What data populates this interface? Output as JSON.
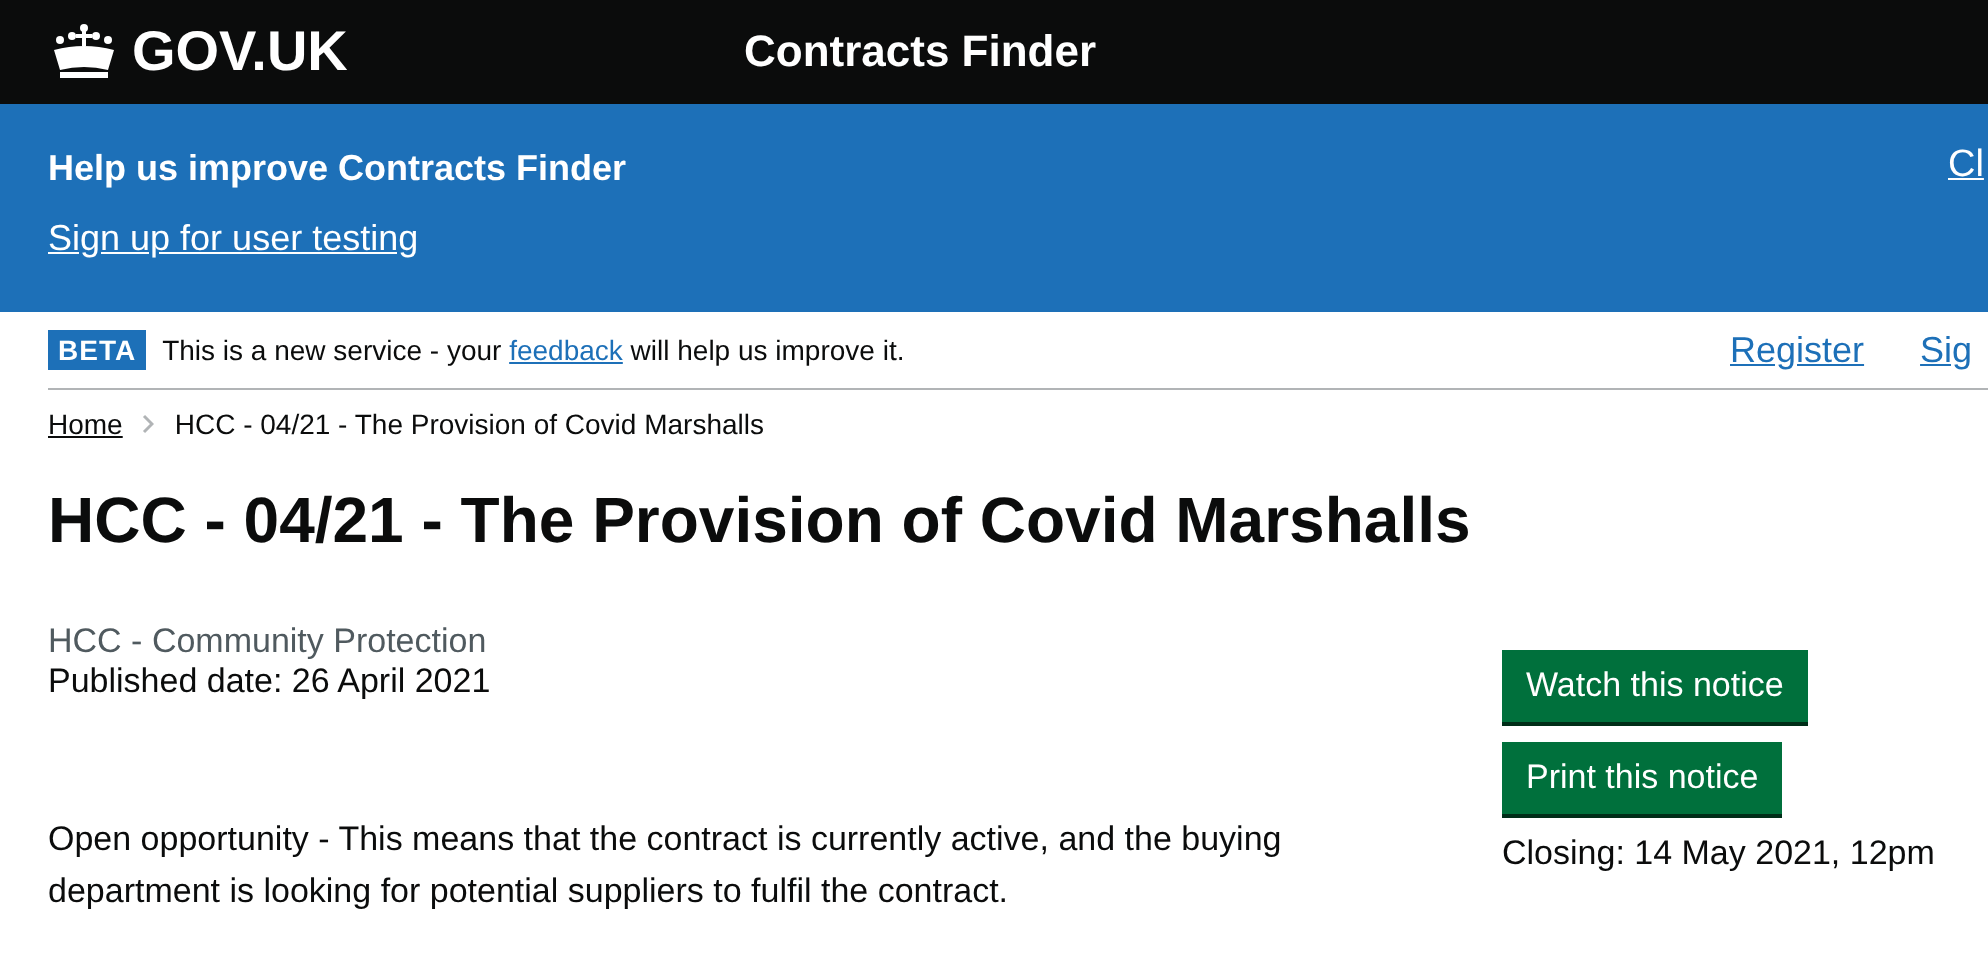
{
  "header": {
    "logo": "GOV.UK",
    "service": "Contracts Finder"
  },
  "banner": {
    "title": "Help us improve Contracts Finder",
    "link": "Sign up for user testing",
    "close": "Cl"
  },
  "phase": {
    "tag": "BETA",
    "before": "This is a new service - your ",
    "link": "feedback",
    "after": " will help us improve it."
  },
  "account_links": [
    "Register",
    "Sig"
  ],
  "breadcrumbs": [
    {
      "label": "Home",
      "link": true
    },
    {
      "label": "HCC - 04/21 - The Provision of Covid Marshalls",
      "link": false
    }
  ],
  "title": "HCC - 04/21 - The Provision of Covid Marshalls",
  "organisation": "HCC - Community Protection",
  "published": "Published date: 26 April 2021",
  "status_text": "Open opportunity - This means that the contract is currently active, and the buying department is looking for potential suppliers to fulfil the contract.",
  "actions": [
    "Watch this notice",
    "Print this notice"
  ],
  "closing": "Closing: 14 May 2021, 12pm"
}
